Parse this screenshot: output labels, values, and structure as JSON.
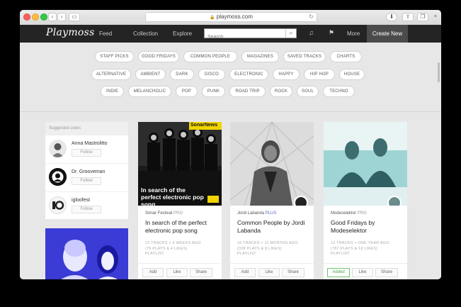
{
  "browser": {
    "url": "playmoss.com",
    "lock_glyph": "🔒",
    "back_glyph": "‹",
    "forward_glyph": "›",
    "sidebar_glyph": "▭",
    "reload_glyph": "↻",
    "download_glyph": "⬇",
    "share_glyph": "⇪",
    "tabs_glyph": "❐",
    "add_tab_glyph": "+"
  },
  "nav": {
    "logo": "Playmoss",
    "links": [
      "Feed",
      "Collection",
      "Explore"
    ],
    "search_placeholder": "Search",
    "search_glyph": "⌕",
    "user_glyph": "♫",
    "flag_glyph": "⚑",
    "more": "More",
    "create": "Create New"
  },
  "tags": [
    [
      "STAFF PICKS",
      "GOOD FRIDAYS",
      "COMMON PEOPLE",
      "MAGAZINES",
      "SAVED TRACKS",
      "CHARTS"
    ],
    [
      "ALTERNATIVE",
      "AMBIENT",
      "DARK",
      "DISCO",
      "ELECTRONIC",
      "HAPPY",
      "HIP HOP",
      "HOUSE"
    ],
    [
      "INDIE",
      "MELANCHOLIC",
      "POP",
      "PUNK",
      "ROAD TRIP",
      "ROCK",
      "SOUL",
      "TECHNO"
    ]
  ],
  "suggested": {
    "heading": "Suggested users",
    "follow_label": "Follow",
    "users": [
      {
        "name": "Anna Mastrolitto"
      },
      {
        "name": "Dr. Grooveman"
      },
      {
        "name": "igloofest"
      }
    ]
  },
  "cards": [
    {
      "author": "Sónar Festival",
      "tier": "PRO",
      "tier_kind": "pro",
      "title": "In search of the perfect electronic pop song",
      "stats": "13 TRACKS > 3 WEEKS AGO",
      "plays": "(75 PLAYS & 4 LIKES)",
      "kind": "PLAYLIST",
      "art_title": "In search of the perfect electronic pop song",
      "art_badge": "SonarNews",
      "add": "Add",
      "like": "Like",
      "share": "Share",
      "added": false
    },
    {
      "author": "Jordi Labanda",
      "tier": "PLUS",
      "tier_kind": "plus",
      "title": "Common People by Jordi Labanda",
      "stats": "10 TRACKS > 11 MONTHS AGO",
      "plays": "(338 PLAYS & 8 LIKES)",
      "kind": "PLAYLIST",
      "add": "Add",
      "like": "Like",
      "share": "Share",
      "added": false
    },
    {
      "author": "Modeselektor",
      "tier": "PRO",
      "tier_kind": "pro",
      "title": "Good Fridays by Modeselektor",
      "stats": "12 TRACKS > ONE YEAR AGO",
      "plays": "(787 PLAYS & 18 LIKES)",
      "kind": "PLAYLIST",
      "add": "Added",
      "like": "Like",
      "share": "Share",
      "added": true
    }
  ]
}
